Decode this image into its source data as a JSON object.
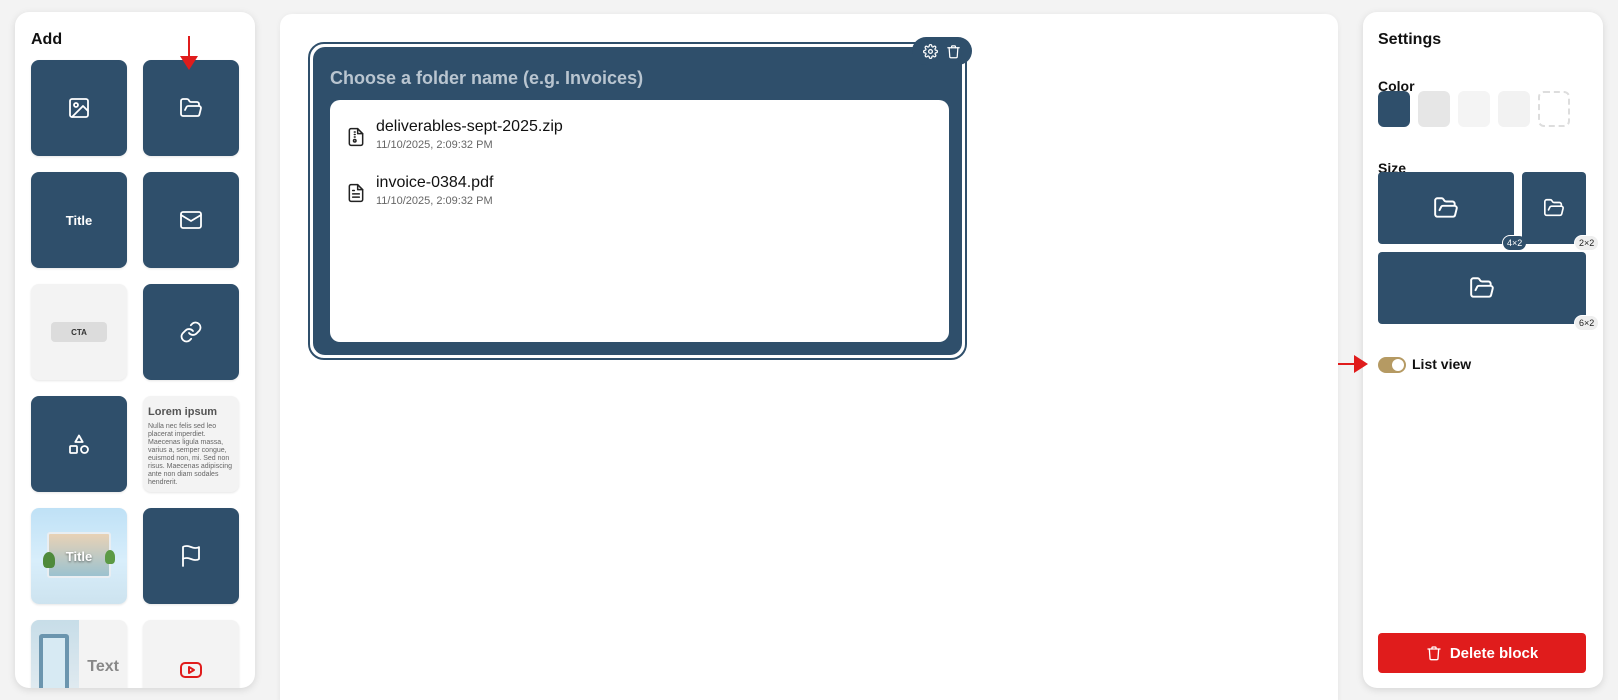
{
  "add_panel": {
    "title": "Add",
    "tiles": {
      "title_text": "Title",
      "cta_text": "CTA",
      "lorem_head": "Lorem ipsum",
      "lorem_body": "Nulla nec felis sed leo placerat imperdiet. Maecenas ligula massa, varius a, semper congue, euismod non, mi. Sed non risus. Maecenas adipiscing ante non diam sodales hendrerit.",
      "image_title": "Title",
      "text_label": "Text"
    }
  },
  "block": {
    "folder_placeholder": "Choose a folder name (e.g. Invoices)",
    "files": [
      {
        "name": "deliverables-sept-2025.zip",
        "date": "11/10/2025, 2:09:32 PM",
        "icon": "zip-file-icon"
      },
      {
        "name": "invoice-0384.pdf",
        "date": "11/10/2025, 2:09:32 PM",
        "icon": "document-file-icon"
      }
    ]
  },
  "settings": {
    "title": "Settings",
    "color_label": "Color",
    "colors": [
      "#2f4f6b",
      "#e6e6e6",
      "#f4f4f4",
      "#f2f2f2",
      "transparent"
    ],
    "size_label": "Size",
    "sizes": [
      "4×2",
      "2×2",
      "6×2"
    ],
    "list_view_label": "List view",
    "list_view_on": true,
    "delete_label": "Delete block"
  }
}
